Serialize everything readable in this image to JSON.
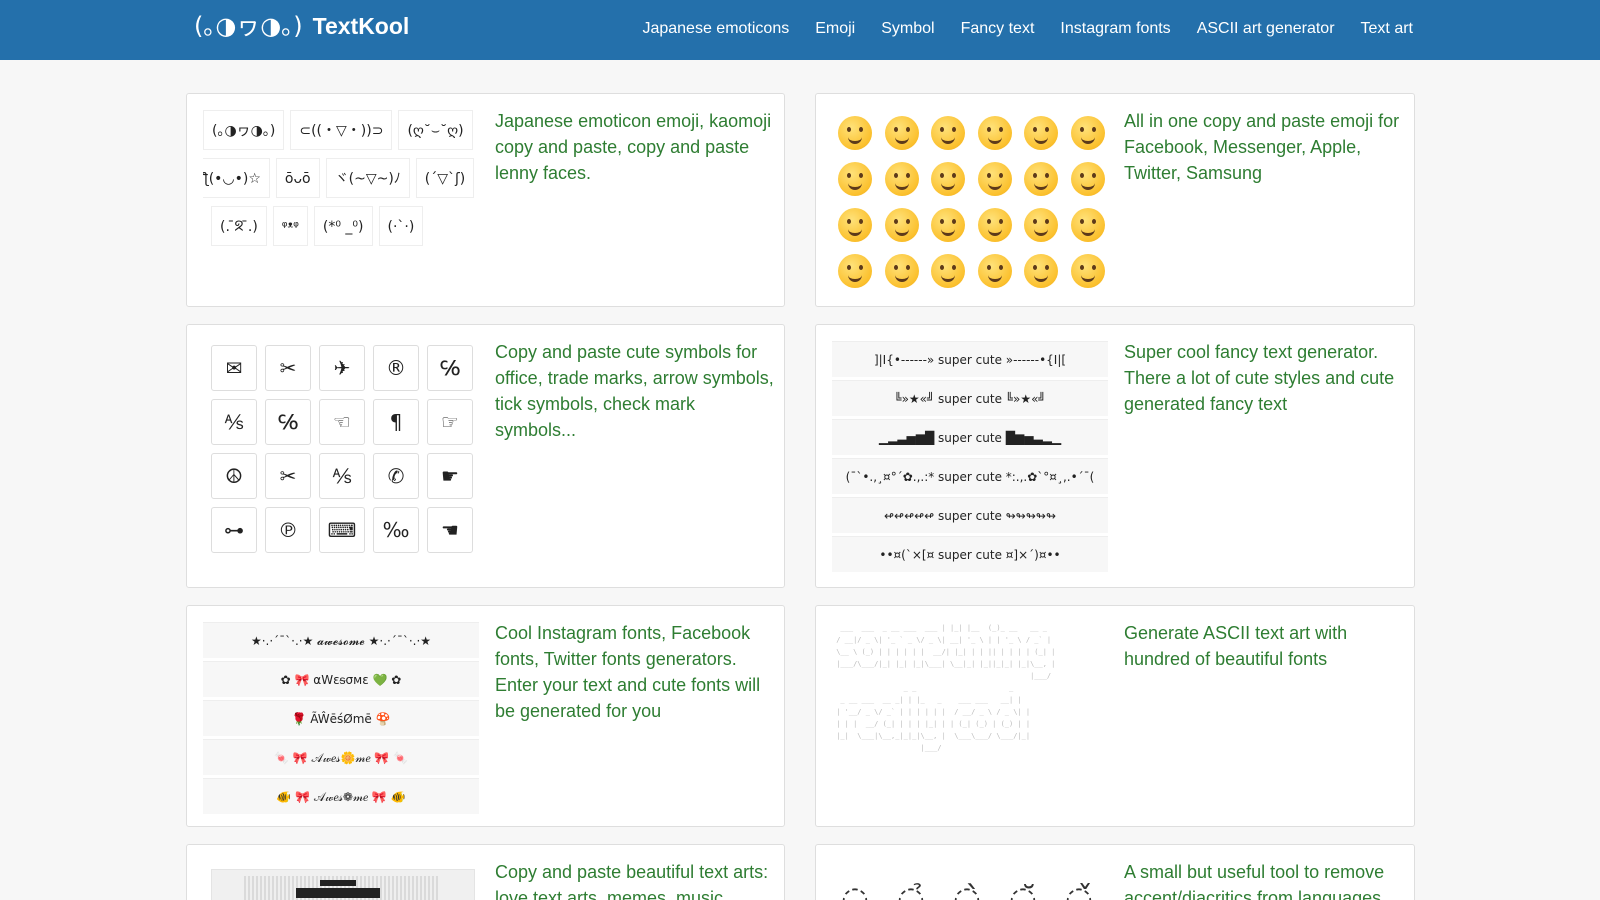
{
  "header": {
    "brand_face": "(｡◑ヮ◑｡)",
    "brand_name": "TextKool",
    "nav": [
      "Japanese emoticons",
      "Emoji",
      "Symbol",
      "Fancy text",
      "Instagram fonts",
      "ASCII art generator",
      "Text art"
    ]
  },
  "cards": {
    "kaomoji": {
      "desc": "Japanese emoticon emoji, kaomoji copy and paste, copy and paste lenny faces.",
      "rows": [
        [
          "(｡◑ヮ◑｡)",
          "⊂((・▽・))⊃",
          "(ღ˘⌣˘ღ)"
        ],
        [
          "ƪ(•◡•)☆",
          "ōᴗō",
          "ヾ(~▽~)ﾉ",
          "(´▽`ʃ)"
        ],
        [
          "(. ̄ᘝ ̄.)",
          "ᵠᵜᵠ",
          "(*⁰ _⁰)",
          "(·ˋ·)"
        ]
      ]
    },
    "emoji": {
      "desc": "All in one copy and paste emoji for Facebook, Messenger, Apple, Twitter, Samsung",
      "count": 24
    },
    "symbol": {
      "desc": "Copy and paste cute symbols for office, trade marks, arrow symbols, tick symbols, check mark symbols...",
      "items": [
        "✉",
        "✂",
        "✈",
        "®",
        "℅",
        "⅍",
        "℅",
        "☜",
        "¶",
        "☞",
        "☮",
        "✂",
        "⅍",
        "✆",
        "☛",
        "⊶",
        "℗",
        "⌨",
        "‰",
        "☚"
      ]
    },
    "fancy": {
      "desc": "Super cool fancy text generator. There a lot of cute styles and cute generated fancy text",
      "rows": [
        "]|I{•------» super cute »------•{I|[",
        "╚»★«╝ super cute ╚»★«╝",
        "▁▂▃▅▆█ super cute █▆▅▃▂▁",
        "(¯`•.,¸¤°´✿.,.:* super cute *:.,.✿`°¤¸,.•´¯(",
        "↫↫↫↫↫ super cute ↬↬↬↬↬",
        "••¤(`×[¤ super cute ¤]×´)¤••"
      ]
    },
    "instagram": {
      "desc": "Cool Instagram fonts, Facebook fonts, Twitter fonts generators. Enter your text and cute fonts will be generated for you",
      "rows": [
        "★·.·´¯`·.·★ 𝓪𝔀𝓮𝓼𝓸𝓶𝓮 ★·.·´¯`·.·★",
        "✿ 🎀 αWεᵴσмε 💚 ✿",
        "🌹 ÃŴēśØmē 🍄",
        "🍬 🎀 𝒜𝓌𝑒𝓈🌼𝓂𝑒 🎀 🍬",
        "🐠 🎀 𝒜𝓌𝑒𝓈❁𝓂𝑒 🎀 🐠"
      ]
    },
    "ascii": {
      "desc": "Generate ASCII text art with hundred of beautiful fonts",
      "art": "  ___  ___  _ __ ___  ___ | |_| |__  (_)_ __   __ _\n / __|/ _ \\| '_ ` _ \\/ _ \\| __| '_ \\ | | '_ \\ / _` |\n \\__ \\ (_) | | | | | |  __/| |_| | | || | | | | (_| |\n |___/\\___/|_| |_| |_|\\___| \\__|_| |_||_|_| |_|\\__, |\n                                               |___/\n                 _ _                      _\n  _ __ ___  __ _| | |_   _    ___ ___   __| |\n | '__/ _ \\/ _` | | | | | |  / __/ _ \\ / _ \\| |\n | | |  __/ (_| | | | |_| | | (_| (_) | (_) | |\n |_|  \\___|\\__,_|_|_|\\__, |  \\___\\___/ \\___/|_|\n                     |___/"
    },
    "textart": {
      "desc": "Copy and paste beautiful text arts: love text arts, memes, music..."
    },
    "diacritics": {
      "desc": "A small but useful tool to remove accent/diacritics from languages",
      "glyphs": [
        "◌",
        "◌̉",
        "◌̀",
        "◌̆",
        "◌̌"
      ]
    }
  }
}
